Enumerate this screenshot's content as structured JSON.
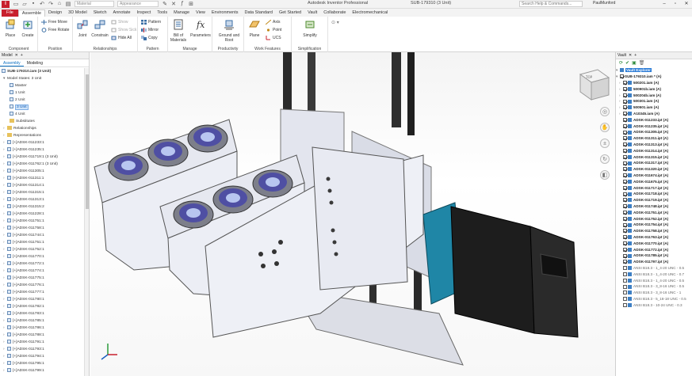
{
  "titlebar": {
    "logo": "I",
    "material_placeholder": "Material",
    "appearance_placeholder": "Appearance",
    "app_title": "Autodesk Inventor Professional",
    "document": "SUB-179310 (3 Unit)",
    "help_search": "Search Help & Commands...",
    "user": "PaulMunford"
  },
  "tabs": [
    "File",
    "Assemble",
    "Design",
    "3D Model",
    "Sketch",
    "Annotate",
    "Inspect",
    "Tools",
    "Manage",
    "View",
    "Environments",
    "Data Standard",
    "Get Started",
    "Vault",
    "Collaborate",
    "Electromechanical"
  ],
  "active_tab": "Assemble",
  "ribbon": {
    "groups": {
      "component": "Component",
      "position": "Position",
      "relationships": "Relationships",
      "pattern": "Pattern",
      "manage": "Manage",
      "productivity": "Productivity",
      "work_features": "Work Features",
      "simplification": "Simplification"
    },
    "buttons": {
      "place": "Place",
      "create": "Create",
      "free_move": "Free Move",
      "free_rotate": "Free Rotate",
      "joint": "Joint",
      "constrain": "Constrain",
      "show": "Show",
      "show_sick": "Show Sick",
      "hide_all": "Hide All",
      "pattern": "Pattern",
      "mirror": "Mirror",
      "copy": "Copy",
      "bill_of_materials": "Bill of Materials",
      "parameters": "Parameters",
      "ground_and_root": "Ground and Root",
      "plane": "Plane",
      "axis": "Axis",
      "point": "Point",
      "ucs": "UCS",
      "simplify": "Simplify"
    }
  },
  "left_browser": {
    "tab": "Model",
    "subtabs": [
      "Assembly",
      "Modeling"
    ],
    "root": "SUB-179310.iam (3 Unit)",
    "model_states": "Model States: 3 Unit",
    "states": [
      "Master",
      "1 Unit",
      "2 Unit",
      "3 Unit",
      "4 Unit"
    ],
    "selected_state": "3 Unit",
    "folders": [
      "Substitutes",
      "Relationships",
      "Representations"
    ],
    "components": [
      "[+]ADSK-011233:1",
      "[+]ADSK-011235:1",
      "[+]ADSK-011719:1 (3 Unit)",
      "[+]ADSK-011762:1 (3 Unit)",
      "[+]ADSK-011305:1",
      "[+]ADSK-011311:1",
      "[+]ADSK-011314:1",
      "[+]ADSK-011315:1",
      "[+]ADSK-011313:1",
      "[+]ADSK-011315:2",
      "[+]ADSK-011228:1",
      "[+]ADSK-011751:1",
      "[+]ADSK-011758:1",
      "[+]ADSK-011744:1",
      "[+]ADSK-011751:1",
      "[+]ADSK-011752:1",
      "[+]ADSK-011770:1",
      "[+]ADSK-011772:1",
      "[+]ADSK-011774:1",
      "[+]ADSK-011775:1",
      "[+]ADSK-011776:1",
      "[+]ADSK-011777:1",
      "[+]ADSK-011780:1",
      "[+]ADSK-011782:1",
      "[+]ADSK-011783:1",
      "[+]ADSK-011785:1",
      "[+]ADSK-011786:1",
      "[+]ADSK-011788:1",
      "[+]ADSK-011791:1",
      "[+]ADSK-011793:1",
      "[+]ADSK-011794:1",
      "[+]ADSK-011795:1",
      "[+]ADSK-011799:1"
    ]
  },
  "right_browser": {
    "tab": "Vault",
    "vault_root": "Vault Explorer",
    "root": "SUB-179310.iam * (A)",
    "rows": [
      {
        "label": "500201.iam (A)",
        "icon": true
      },
      {
        "label": "500901b.iam (A)",
        "icon": true
      },
      {
        "label": "500204b.iam (A)",
        "icon": true
      },
      {
        "label": "500301.iam (A)",
        "icon": true
      },
      {
        "label": "500501.iam (A)",
        "icon": true
      },
      {
        "label": "A10345.iam (A)",
        "icon": true
      },
      {
        "label": "ADSK-011233.ipt (A)"
      },
      {
        "label": "ADSK-011235.ipt (A)"
      },
      {
        "label": "ADSK-011305.ipt (A)"
      },
      {
        "label": "ADSK-011311.ipt (A)"
      },
      {
        "label": "ADSK-011313.ipt (A)"
      },
      {
        "label": "ADSK-011314.ipt (A)"
      },
      {
        "label": "ADSK-011315.ipt (A)"
      },
      {
        "label": "ADSK-011317.ipt (A)"
      },
      {
        "label": "ADSK-011320.ipt (A)"
      },
      {
        "label": "ADSK-011674.ipt (A)"
      },
      {
        "label": "ADSK-011675.ipt (A)"
      },
      {
        "label": "ADSK-011717.ipt (A)"
      },
      {
        "label": "ADSK-011718.ipt (A)"
      },
      {
        "label": "ADSK-011719.ipt (A)"
      },
      {
        "label": "ADSK-011748.ipt (A)"
      },
      {
        "label": "ADSK-011751.ipt (A)"
      },
      {
        "label": "ADSK-011752.ipt (A)"
      },
      {
        "label": "ADSK-011754.ipt (A)"
      },
      {
        "label": "ADSK-011758.ipt (A)"
      },
      {
        "label": "ADSK-011763.ipt (A)"
      },
      {
        "label": "ADSK-011770.ipt (A)"
      },
      {
        "label": "ADSK-011772.ipt (A)"
      },
      {
        "label": "ADSK-011785.ipt (A)"
      },
      {
        "label": "ADSK-011797.ipt (A)"
      },
      {
        "label": "ANSI B18.3 - 1_4-20 UNC - 0.5",
        "plain": true
      },
      {
        "label": "ANSI B18.3 - 1_4-20 UNC - 0.7",
        "plain": true
      },
      {
        "label": "ANSI B18.3 - 1_4-20 UNC - 0.5",
        "plain": true
      },
      {
        "label": "ANSI B18.3 - 3_8-16 UNC - 0.5",
        "plain": true
      },
      {
        "label": "ANSI B18.3 - 3_8-16 UNC - 1",
        "plain": true
      },
      {
        "label": "ANSI B18.3 - 5_16-18 UNC - 0.5",
        "plain": true
      },
      {
        "label": "ANSI B18.3 - 10-24 UNC - 0.3",
        "plain": true
      }
    ]
  },
  "colors": {
    "file_tab": "#c8202d",
    "accent_blue": "#0a6fc2",
    "motor_teal": "#1c7f9c",
    "motor_body": "#1c1c1c",
    "plate": "#e9ebf2"
  },
  "icons": [
    "app-logo-icon",
    "save-icon",
    "undo-icon",
    "redo-icon",
    "search-icon",
    "viewcube-icon",
    "navigation-wheel-icon",
    "pan-icon",
    "zoom-icon",
    "orbit-icon",
    "look-at-icon"
  ]
}
